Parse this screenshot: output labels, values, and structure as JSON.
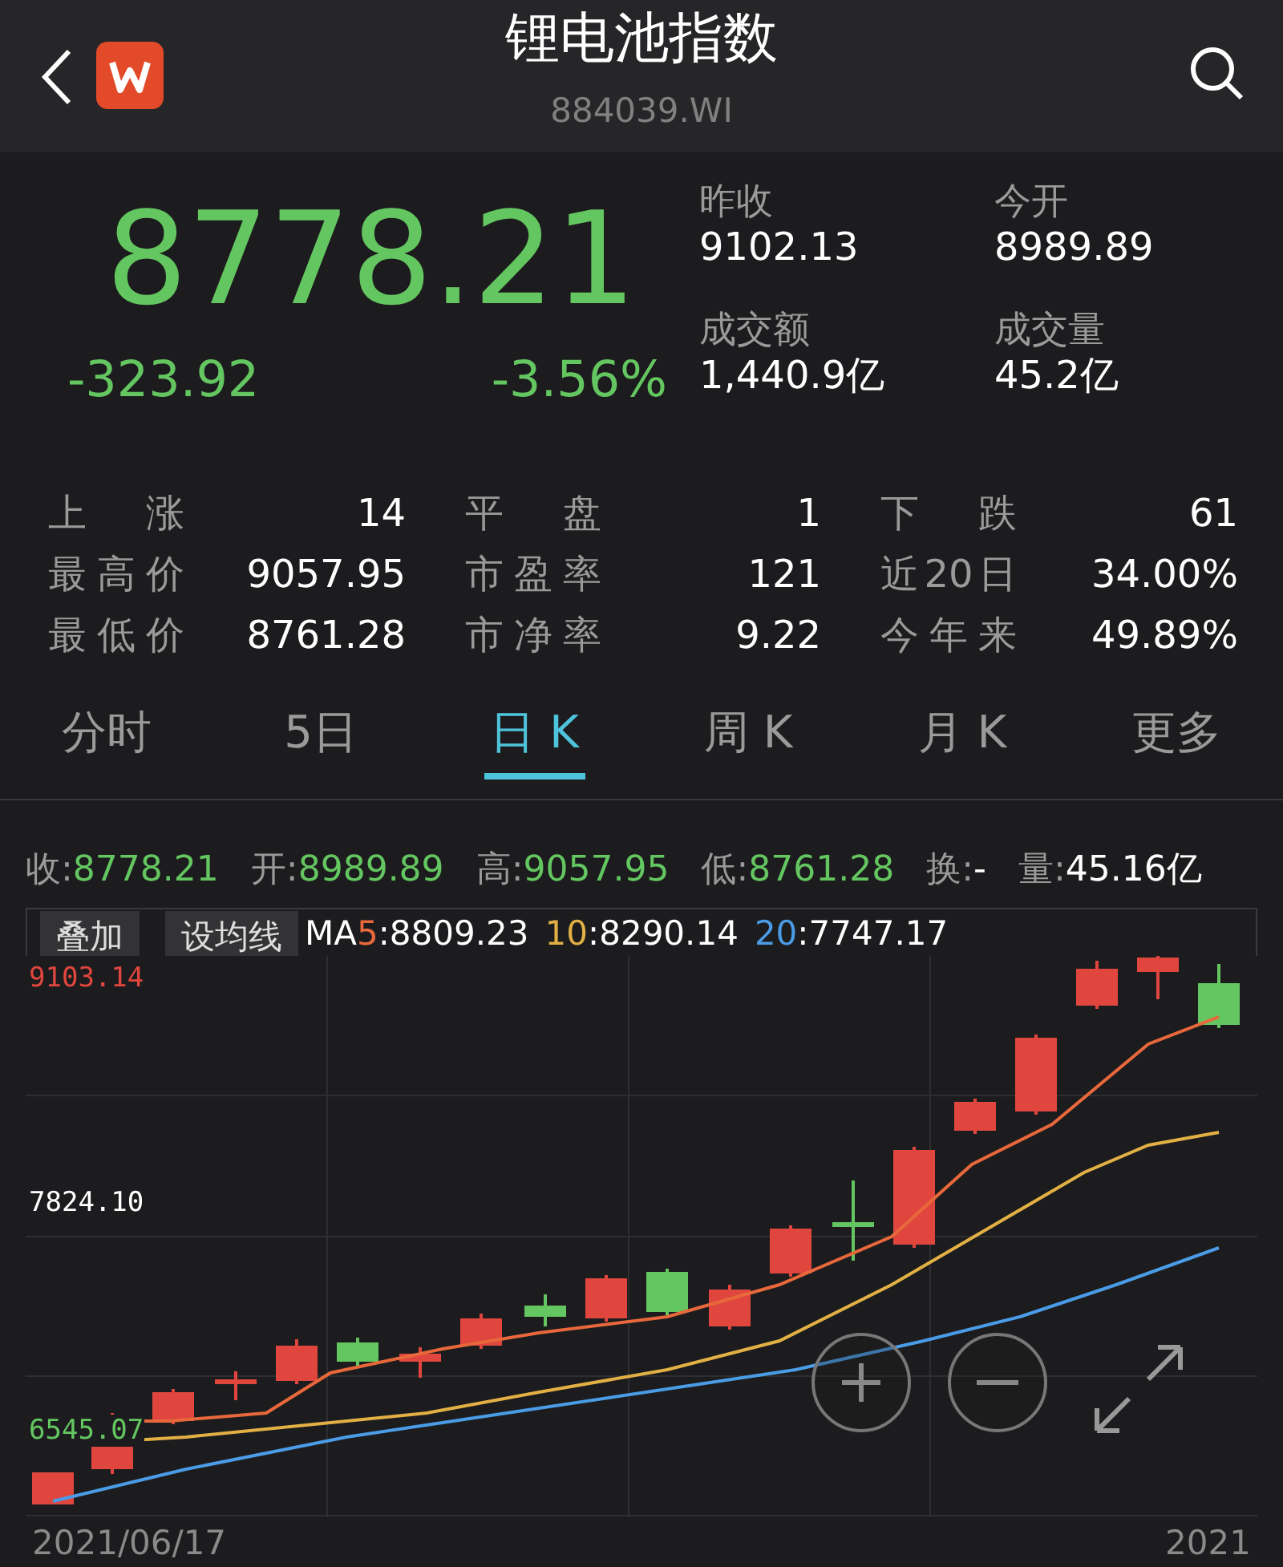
{
  "header": {
    "title": "锂电池指数",
    "code": "884039.WI"
  },
  "quote": {
    "price": "8778.21",
    "change": "-323.92",
    "change_pct": "-3.56%",
    "color": "#64c660"
  },
  "summary": [
    {
      "label": "昨收",
      "value": "9102.13"
    },
    {
      "label": "今开",
      "value": "8989.89"
    },
    {
      "label": "成交额",
      "value": "1,440.9亿"
    },
    {
      "label": "成交量",
      "value": "45.2亿"
    }
  ],
  "stats": [
    {
      "label": "上 涨",
      "value": "14"
    },
    {
      "label": "平 盘",
      "value": "1"
    },
    {
      "label": "下 跌",
      "value": "61"
    },
    {
      "label": "最高价",
      "value": "9057.95"
    },
    {
      "label": "市盈率",
      "value": "121"
    },
    {
      "label": "近20日",
      "value": "34.00%"
    },
    {
      "label": "最低价",
      "value": "8761.28"
    },
    {
      "label": "市净率",
      "value": "9.22"
    },
    {
      "label": "今年来",
      "value": "49.89%"
    }
  ],
  "tabs": [
    {
      "label": "分时",
      "selected": false
    },
    {
      "label": "5日",
      "selected": false
    },
    {
      "label": "日 K",
      "selected": true
    },
    {
      "label": "周 K",
      "selected": false
    },
    {
      "label": "月 K",
      "selected": false
    },
    {
      "label": "更多",
      "selected": false
    }
  ],
  "ohlc": [
    {
      "label": "收:",
      "value": "8778.21",
      "color": "#64c660"
    },
    {
      "label": "开:",
      "value": "8989.89",
      "color": "#64c660"
    },
    {
      "label": "高:",
      "value": "9057.95",
      "color": "#64c660"
    },
    {
      "label": "低:",
      "value": "8761.28",
      "color": "#64c660"
    },
    {
      "label": "换:",
      "value": "-",
      "color": "#ffffff"
    },
    {
      "label": "量:",
      "value": "45.16亿",
      "color": "#ffffff"
    }
  ],
  "chart": {
    "buttons": [
      "叠加",
      "设均线"
    ],
    "ma_prefix": "MA",
    "ma": [
      {
        "period": "5",
        "value": ":8809.23",
        "color": "#e8683c"
      },
      {
        "period": "10",
        "value": ":8290.14",
        "color": "#e2b044"
      },
      {
        "period": "20",
        "value": ":7747.17",
        "color": "#4a9ce6"
      }
    ],
    "y_labels": [
      {
        "text": "9103.14",
        "color": "#e0463e"
      },
      {
        "text": "7824.10",
        "color": "#ffffff"
      },
      {
        "text": "6545.07",
        "color": "#64c660"
      }
    ],
    "dates": [
      "2021/06/17",
      "2021"
    ]
  }
}
